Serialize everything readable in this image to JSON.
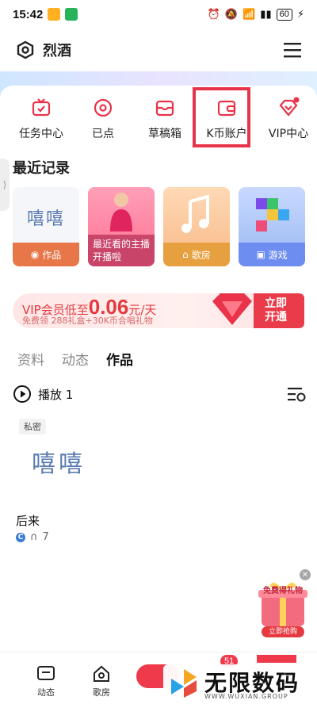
{
  "status_bar": {
    "time": "15:42",
    "battery": "60"
  },
  "header": {
    "title": "烈酒"
  },
  "quick_actions": [
    {
      "label": "任务中心",
      "icon": "tv-icon"
    },
    {
      "label": "已点",
      "icon": "disc-icon"
    },
    {
      "label": "草稿箱",
      "icon": "draft-box-icon"
    },
    {
      "label": "K币账户",
      "icon": "wallet-icon"
    },
    {
      "label": "VIP中心",
      "icon": "vip-diamond-icon"
    }
  ],
  "recent": {
    "title": "最近记录",
    "items": [
      {
        "art_text": "嘻嘻",
        "caption": "作品"
      },
      {
        "caption": "最近看的主播开播啦"
      },
      {
        "caption": "歌房"
      },
      {
        "caption": "游戏"
      }
    ]
  },
  "vip_banner": {
    "prefix": "VIP会员低至",
    "price": "0.06",
    "suffix": "元/天",
    "sub": "免费领 288礼盒+30K币合唱礼物",
    "cta_line1": "立即",
    "cta_line2": "开通"
  },
  "tabs": [
    "资料",
    "动态",
    "作品"
  ],
  "play": {
    "label": "播放 1"
  },
  "work": {
    "badge": "私密",
    "art_text": "嘻嘻",
    "title": "后来",
    "meta_letter": "C",
    "plays": "7"
  },
  "float_ad": {
    "title": "免费得礼物",
    "footer": "立即抢购"
  },
  "bottom_nav": {
    "items": [
      {
        "label": "动态"
      },
      {
        "label": "歌房"
      }
    ],
    "badge": "51"
  },
  "watermark": {
    "text": "无限数码",
    "sub": "WWW.WUXIAN.GROUP"
  },
  "colors": {
    "accent": "#e8334a",
    "vip_red": "#e53940"
  }
}
